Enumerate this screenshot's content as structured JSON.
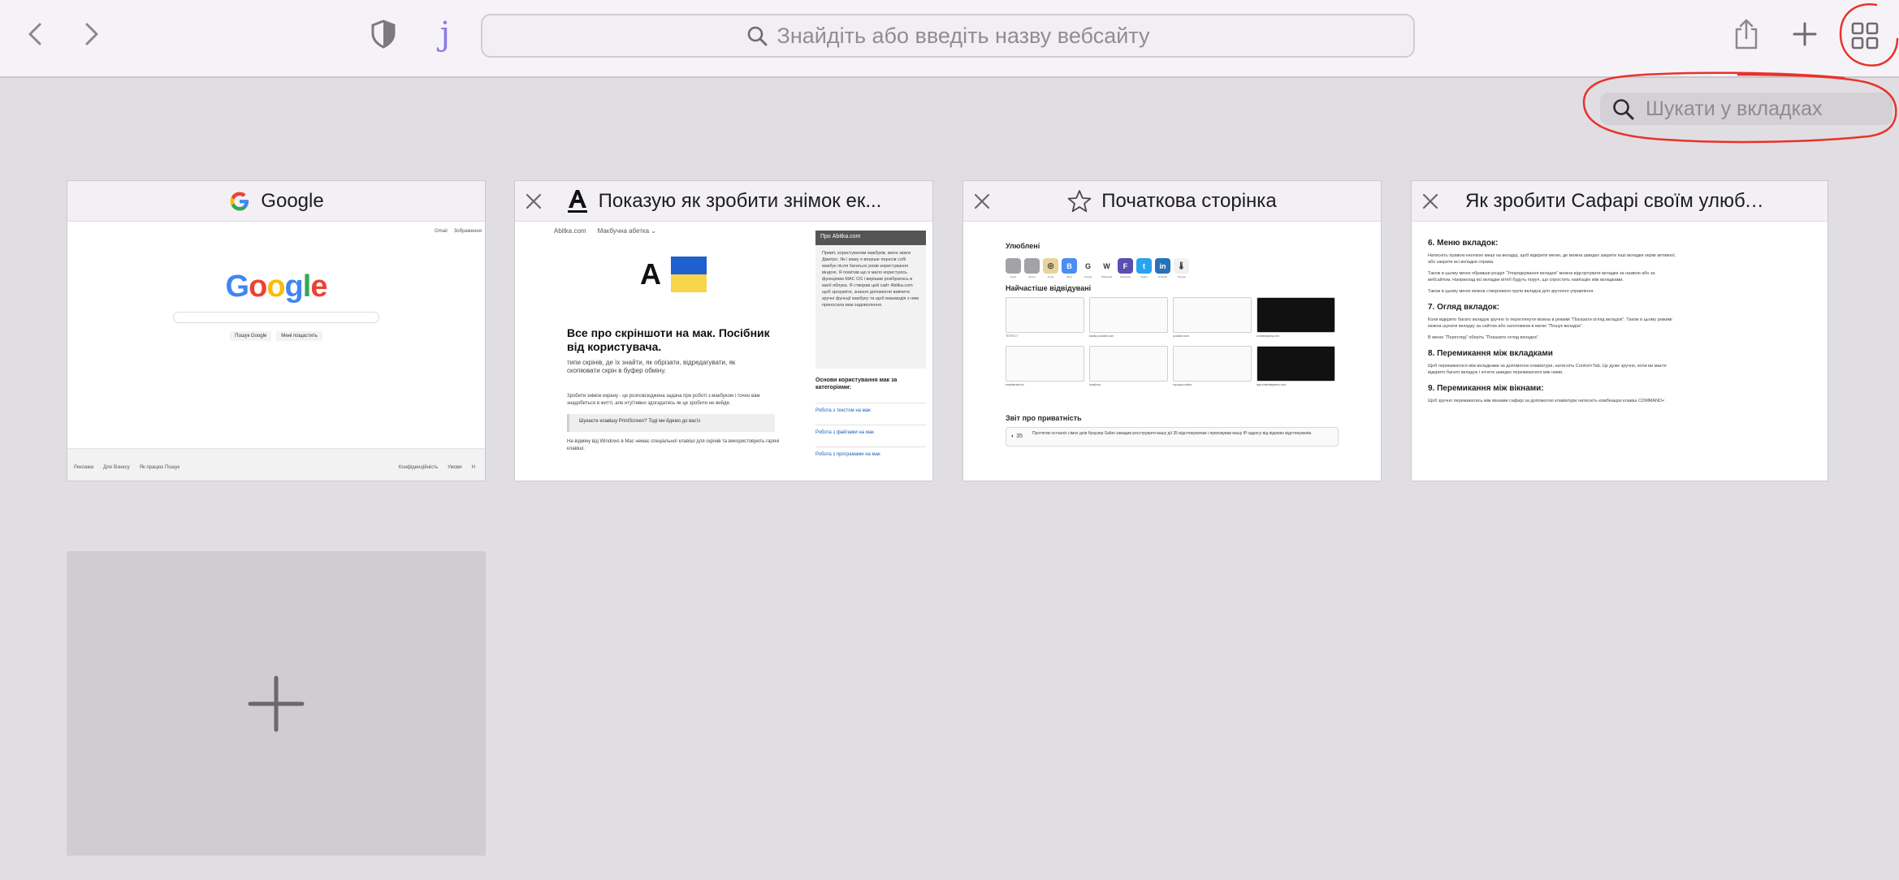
{
  "toolbar": {
    "address_placeholder": "Знайдіть або введіть назву вебсайту",
    "extension_letter": "j",
    "icons": [
      "chevron-left-icon",
      "chevron-right-icon",
      "shield-icon",
      "search-icon",
      "share-icon",
      "plus-icon",
      "grid-icon"
    ]
  },
  "tab_search": {
    "placeholder": "Шукати у вкладках"
  },
  "annotation_color": "#e8322b",
  "tabs": [
    {
      "title": "Google",
      "favicon": "google-icon",
      "thumb": {
        "top_links": [
          "Gmail",
          "Зображення"
        ],
        "logo": "Google",
        "buttons": [
          "Пошук Google",
          "Мені пощастить"
        ],
        "footer_left": [
          "Реклама",
          "Для бізнесу",
          "Як працює Пошук"
        ],
        "footer_right": [
          "Конфіденційність",
          "Умови",
          "Н"
        ]
      }
    },
    {
      "title": "Показую як зробити знімок ек...",
      "favicon": "abitka-icon",
      "thumb": {
        "nav": [
          "Abitka.com",
          "Макбучна абетка ⌄"
        ],
        "logo_letter": "A",
        "heading": "Все про скріншоти на мак. Посібник від користувача.",
        "subtext": "типи скрінів, де їх знайти, як обрізати, відредагувати, як скопіювати скрін в буфер обміну.",
        "para1": "Зробити знімок екрану - це розповсюджена задача при роботі з макбуком і точно вам знадобиться в житті, але нтуїтивно здогадатись як це зробити не вийде.",
        "quote": "Шукаєте клавішу PrintScreen? Тоді ми йдемо до вас!з",
        "para2": "На відміну від Windows в Mac немає спеціальної клавіші для скрінів та використовують гарячі клавіші.",
        "side_header": "Про Abitka.com",
        "side_body": "Привіт, користувачам макбуків, мене звати Дмитро. Як і ваму я вперше пересів собі макбук після багатьох років користування віндою. Я помітив що я мало користуюсь функціями MAC OS і вирішив розібратись в магії яблука. Я створив цей сайт Abitka.com щоб зрозуміти, знання допомогли вивчити зручні функції макбуку та щоб взаємодія з ним приносила вам задоволення.",
        "side_heading": "Основи користування мак за категоріями:",
        "side_links": [
          "Робота з текстом на мак",
          "Робота з файлами на мак",
          "Робота з програмами на мак"
        ]
      }
    },
    {
      "title": "Початкова сторінка",
      "favicon": "star-icon",
      "thumb": {
        "favorites_heading": "Улюблені",
        "favorites": [
          {
            "label": "Apple",
            "glyph": "",
            "color": "#a2a2a7"
          },
          {
            "label": "iCloud",
            "glyph": "",
            "color": "#a2a2a7"
          },
          {
            "label": "ok-tar",
            "glyph": "◎",
            "color": "#e8d49a"
          },
          {
            "label": "Bing",
            "glyph": "B",
            "color": "#4a8df5"
          },
          {
            "label": "Google",
            "glyph": "G",
            "color": "#ffffff"
          },
          {
            "label": "Wikipedia",
            "glyph": "W",
            "color": "#ffffff"
          },
          {
            "label": "Facebook",
            "glyph": "F",
            "color": "#5a4fb0"
          },
          {
            "label": "Twitter",
            "glyph": "t",
            "color": "#2aa3ef"
          },
          {
            "label": "LinkedIn",
            "glyph": "in",
            "color": "#2872b8"
          },
          {
            "label": "Погода",
            "glyph": "🌡",
            "color": "#f1f1f4"
          }
        ],
        "frequent_heading": "Найчастіше відвідувані",
        "frequent": [
          {
            "caption": "TETR.E.T",
            "dark": false
          },
          {
            "caption": "studio.youtube.com",
            "dark": false
          },
          {
            "caption": "youtube.com",
            "dark": false
          },
          {
            "caption": "contentplanly.com",
            "dark": true
          },
          {
            "caption": "smartlender.kz",
            "dark": false
          },
          {
            "caption": "localhost",
            "dark": false
          },
          {
            "caption": "my.aspa.online",
            "dark": false
          },
          {
            "caption": "app.entertaspamis.com",
            "dark": true
          }
        ],
        "privacy_heading": "Звіт про приватність",
        "privacy_count": "35",
        "privacy_text": "Протягом останніх сімох днів браузер Safari завадив реєструвати вашу дії 35 відстежувачам і приховував вашу IP-адресу від відомих відстежувачів."
      }
    },
    {
      "title": "Як зробити Сафарі своїм улюбле...",
      "favicon": "",
      "thumb": {
        "sections": [
          {
            "heading": "6. Меню вкладок:",
            "paras": [
              "Натисніть правою кнопкою миші на вкладці, щоб відкрити меню, де можна швидко закрити інші вкладки окрім активної, або закрити всі вкладки справа.",
              "Також в цьому меню обравши розділ “Упорядкування вкладок” можна відсортувати вкладки за назвою або за вебсайтом. Наприклад всі вкладки вітеб будуть поруч, що спростить навігацію між вкладками.",
              "Також в цьому меню можна створювати групи вкладок для зручного управління."
            ]
          },
          {
            "heading": "7. Огляд вкладок:",
            "paras": [
              "Коли відкрито багато вкладок зручно їх переглянути можна в режимі “Показати огляд вкладок”. Також в цьому режимі можна шукати вкладку за сайтом або заголовком в меню “Пошук вкладок”.",
              "В меню “Перегляд” оберіть “Показати огляд вкладок”."
            ]
          },
          {
            "heading": "8. Перемикання між вкладками",
            "paras": [
              "Щоб перемикатися між вкладками за допомогою клавіатури, натисніть Control+Tab. Це дуже зручно, коли ви маєте відкрито багато вкладок і хочете швидко перемикатися між ними."
            ]
          },
          {
            "heading": "9. Перемикання між вікнами:",
            "paras": [
              "Щоб зручно перемикатись між вікнами сафарі за допомогою клавіатури натисніть комбінацію клавіш COMMAND+`."
            ]
          }
        ]
      }
    }
  ],
  "new_tab": {
    "icon": "plus-icon"
  }
}
